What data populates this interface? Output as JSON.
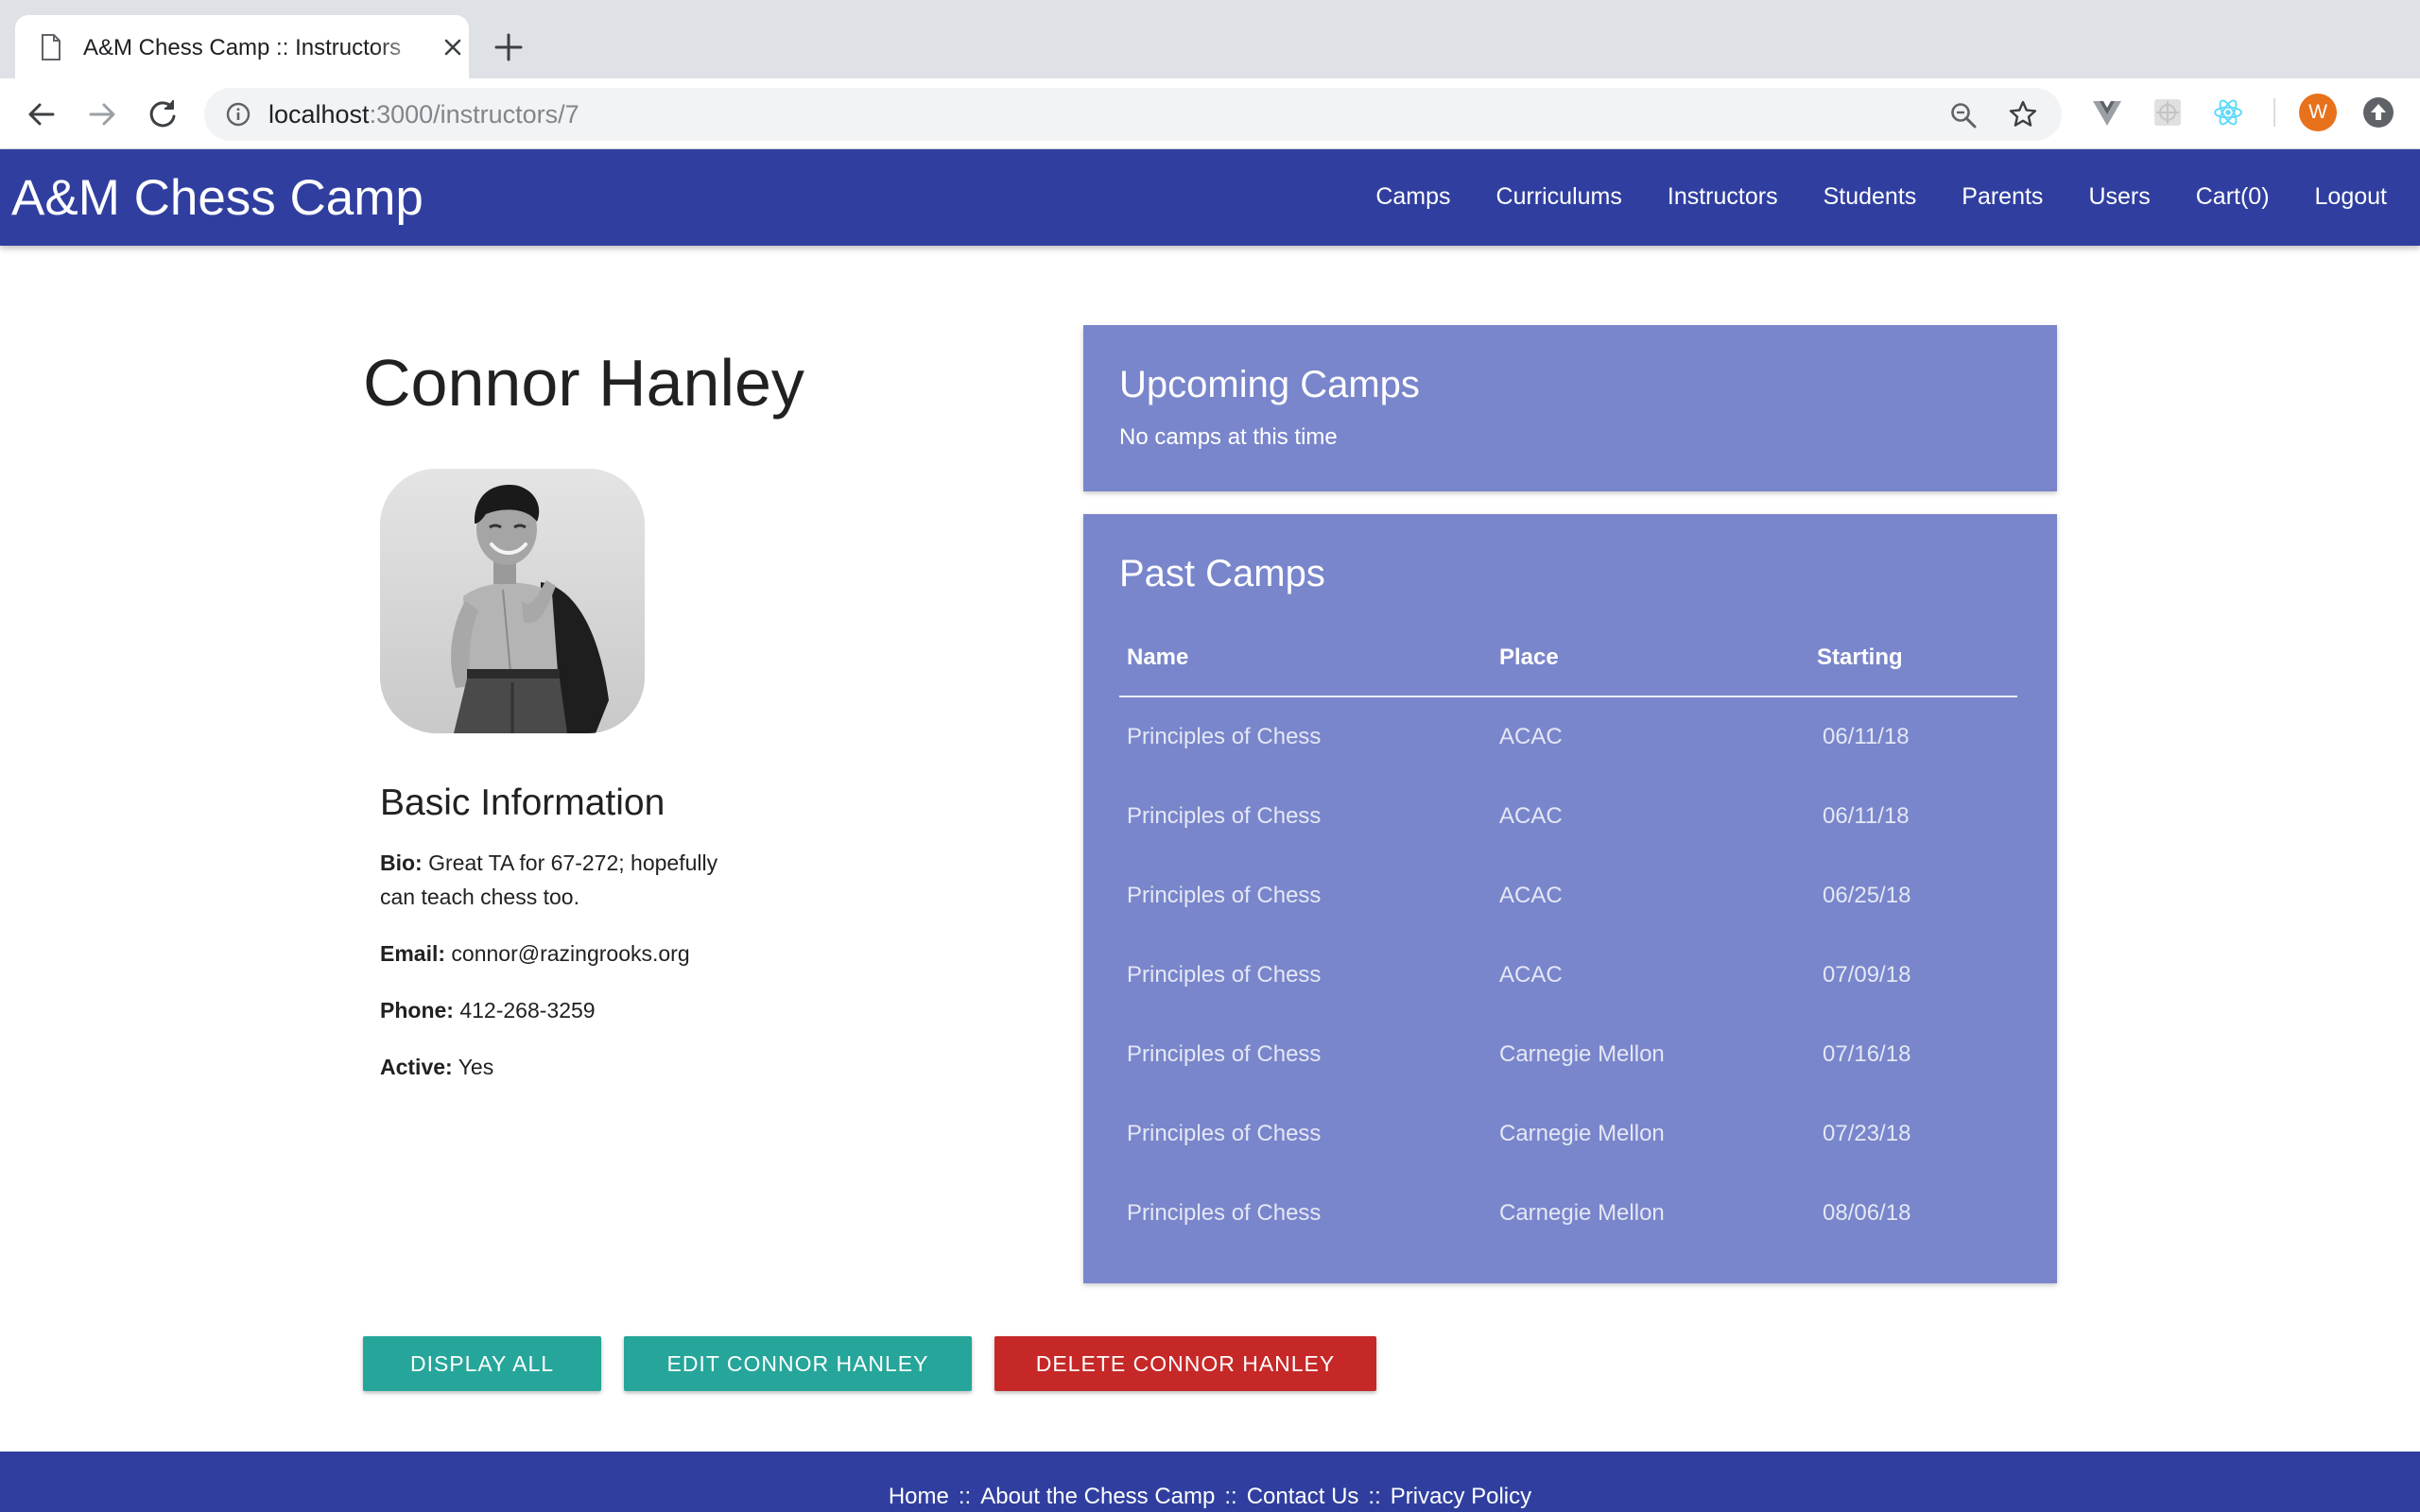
{
  "browser": {
    "tab_title": "A&M Chess Camp :: Instructors",
    "url_host": "localhost",
    "url_path": ":3000/instructors/7",
    "avatar_letter": "W"
  },
  "navbar": {
    "brand": "A&M Chess Camp",
    "links": [
      "Camps",
      "Curriculums",
      "Instructors",
      "Students",
      "Parents",
      "Users",
      "Cart(0)",
      "Logout"
    ]
  },
  "instructor": {
    "name": "Connor Hanley",
    "basic_info_title": "Basic Information",
    "bio_label": "Bio:",
    "bio": "Great TA for 67-272; hopefully can teach chess too.",
    "email_label": "Email:",
    "email": "connor@razingrooks.org",
    "phone_label": "Phone:",
    "phone": "412-268-3259",
    "active_label": "Active:",
    "active": "Yes"
  },
  "upcoming": {
    "title": "Upcoming Camps",
    "empty_text": "No camps at this time"
  },
  "past": {
    "title": "Past Camps",
    "headers": [
      "Name",
      "Place",
      "Starting"
    ],
    "rows": [
      [
        "Principles of Chess",
        "ACAC",
        "06/11/18"
      ],
      [
        "Principles of Chess",
        "ACAC",
        "06/11/18"
      ],
      [
        "Principles of Chess",
        "ACAC",
        "06/25/18"
      ],
      [
        "Principles of Chess",
        "ACAC",
        "07/09/18"
      ],
      [
        "Principles of Chess",
        "Carnegie Mellon",
        "07/16/18"
      ],
      [
        "Principles of Chess",
        "Carnegie Mellon",
        "07/23/18"
      ],
      [
        "Principles of Chess",
        "Carnegie Mellon",
        "08/06/18"
      ]
    ]
  },
  "buttons": {
    "display_all": "DISPLAY ALL",
    "edit": "EDIT CONNOR HANLEY",
    "delete": "DELETE CONNOR HANLEY"
  },
  "footer": {
    "links": [
      "Home",
      "About the Chess Camp",
      "Contact Us",
      "Privacy Policy"
    ],
    "separator": "::"
  },
  "colors": {
    "navbar": "#303f9f",
    "card": "#7986cb",
    "teal_button": "#26a69a",
    "red_button": "#c62828"
  }
}
